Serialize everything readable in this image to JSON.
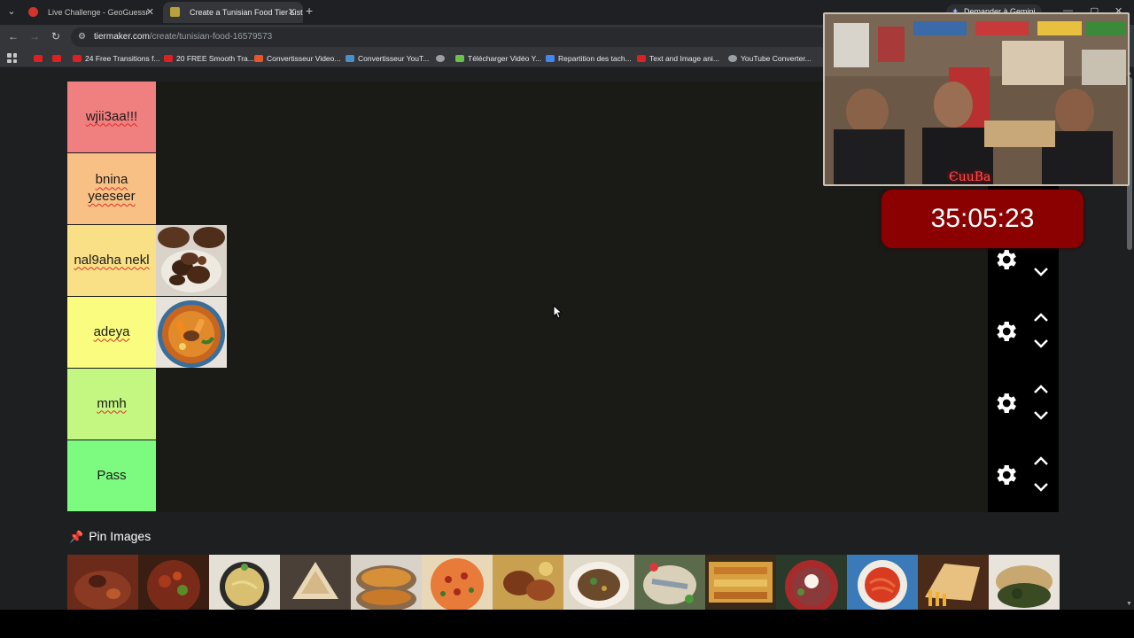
{
  "browser": {
    "tabs": [
      {
        "title": "Live Challenge - GeoGuessr",
        "active": false
      },
      {
        "title": "Create a Tunisian Food Tier List",
        "active": true
      }
    ],
    "gemini_label": "Demander à Gemini",
    "url_domain": "tiermaker.com",
    "url_path": "/create/tunisian-food-16579573",
    "bookmarks": [
      {
        "label": "",
        "icon": "youtube-icon"
      },
      {
        "label": "",
        "icon": "youtube-icon"
      },
      {
        "label": "24 Free Transitions f...",
        "icon": "youtube-icon"
      },
      {
        "label": "20 FREE Smooth Tra...",
        "icon": "youtube-icon"
      },
      {
        "label": "Convertisseur Video...",
        "icon": "z-icon"
      },
      {
        "label": "Convertisseur YouT...",
        "icon": "converter-icon"
      },
      {
        "label": "",
        "icon": "globe-icon"
      },
      {
        "label": "Télécharger Vidéo Y...",
        "icon": "download-icon"
      },
      {
        "label": "Repartition des tach...",
        "icon": "docs-icon"
      },
      {
        "label": "Text and Image ani...",
        "icon": "youtube-icon"
      },
      {
        "label": "YouTube Converter...",
        "icon": "globe-icon"
      }
    ]
  },
  "tiers": [
    {
      "label": "wjii3aa!!!",
      "color": "#f07f80",
      "spellcheck": true,
      "items": []
    },
    {
      "label": "bnina yeeseer",
      "color": "#f8c085",
      "spellcheck": true,
      "items": []
    },
    {
      "label": "nal9aha nekl",
      "color": "#f9df85",
      "spellcheck": true,
      "items": [
        "grilled-meat"
      ]
    },
    {
      "label": "adeya",
      "color": "#fafc80",
      "spellcheck": true,
      "items": [
        "couscous"
      ]
    },
    {
      "label": "mmh",
      "color": "#c3f781",
      "spellcheck": true,
      "items": []
    },
    {
      "label": "Pass",
      "color": "#7dfa80",
      "spellcheck": false,
      "items": []
    }
  ],
  "pin_images": {
    "title": "Pin Images",
    "count": 14
  },
  "overlay": {
    "timer": "35:05:23",
    "cam_banner": "ЄuuBa"
  }
}
